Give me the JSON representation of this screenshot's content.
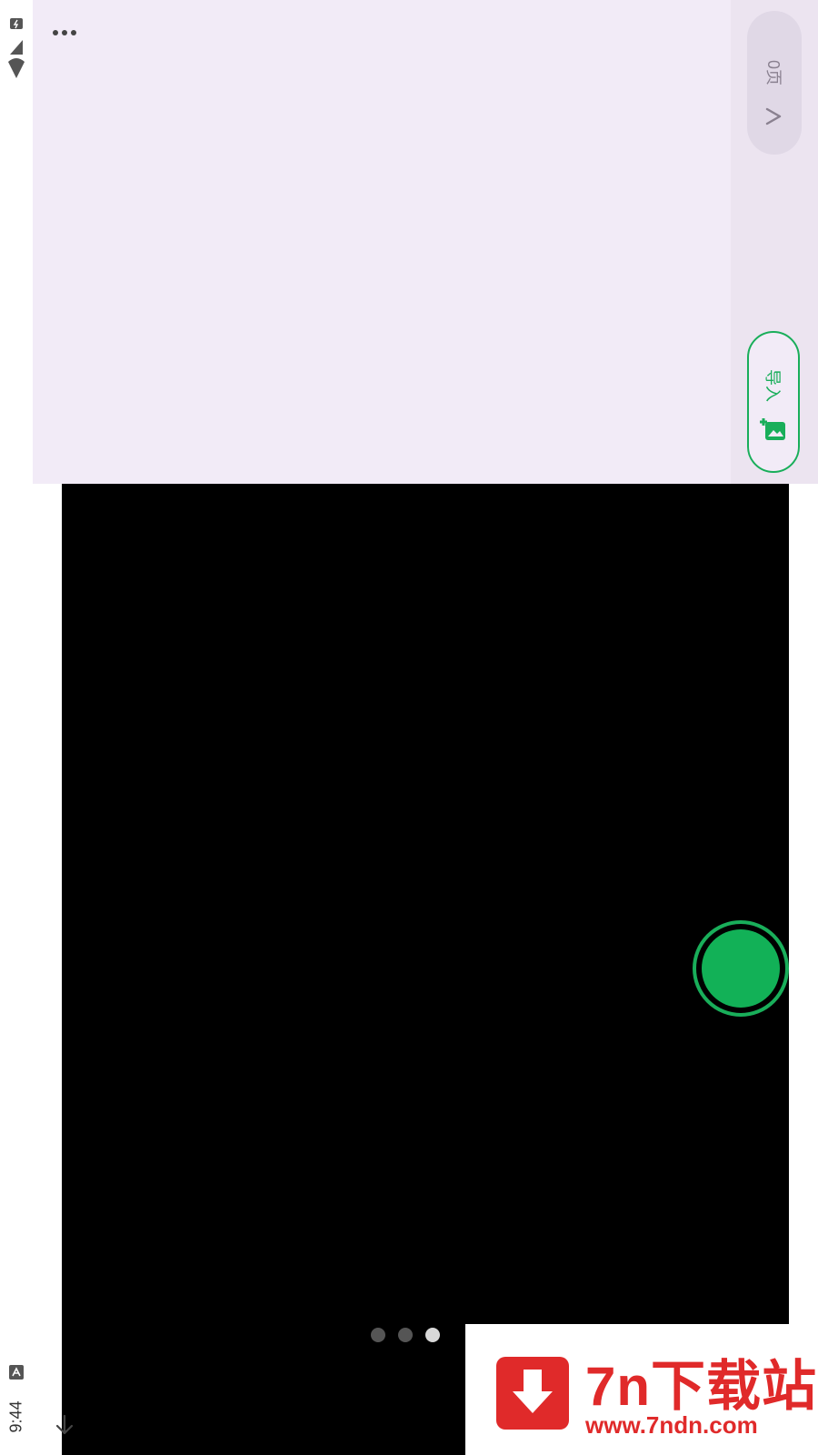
{
  "status_bar": {
    "time": "9:44",
    "icons": [
      "battery-icon",
      "signal-icon",
      "wifi-icon",
      "notification-a-icon"
    ]
  },
  "top_panel": {
    "more_icon": "more-dots-icon",
    "page_button": {
      "label": "0页",
      "icon": "chevron-right-icon"
    },
    "import_button": {
      "label": "导入",
      "icon": "add-image-icon"
    }
  },
  "camera": {
    "shutter_icon": "shutter-button",
    "page_dots": {
      "count": 3,
      "active_index": 2
    }
  },
  "nav": {
    "down_icon": "arrow-down-icon"
  },
  "watermark": {
    "title": "7n下载站",
    "url": "www.7ndn.com",
    "icon": "download-arrow-icon"
  },
  "colors": {
    "accent": "#19ae5a",
    "panel_bg": "#f2ebf7",
    "watermark_red": "#e02a2a"
  }
}
